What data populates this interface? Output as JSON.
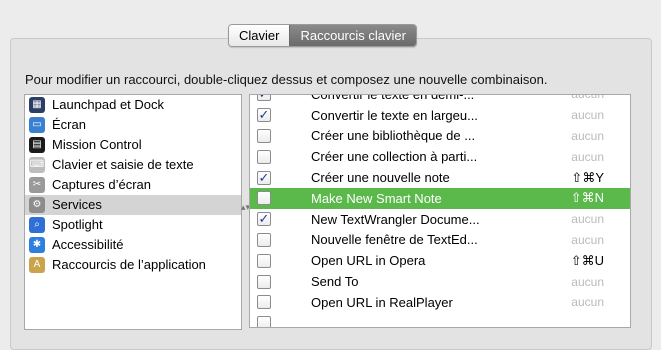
{
  "tabs": [
    {
      "label": "Clavier",
      "selected": false
    },
    {
      "label": "Raccourcis clavier",
      "selected": true
    }
  ],
  "instructions": "Pour modifier un raccourci, double-cliquez dessus et composez une nouvelle combinaison.",
  "categories": [
    {
      "label": "Launchpad et Dock",
      "icon": "launchpad-icon",
      "color": "#2d3e66"
    },
    {
      "label": "Écran",
      "icon": "display-icon",
      "color": "#3b7fd0"
    },
    {
      "label": "Mission Control",
      "icon": "mission-control-icon",
      "color": "#1b1b1b"
    },
    {
      "label": "Clavier et saisie de texte",
      "icon": "keyboard-icon",
      "color": "#bdbdbd"
    },
    {
      "label": "Captures d’écran",
      "icon": "screenshot-icon",
      "color": "#9a9a9a"
    },
    {
      "label": "Services",
      "icon": "gear-icon",
      "color": "#8c8c8c",
      "selected": true
    },
    {
      "label": "Spotlight",
      "icon": "spotlight-icon",
      "color": "#2f6fd6"
    },
    {
      "label": "Accessibilité",
      "icon": "accessibility-icon",
      "color": "#2f7fe0"
    },
    {
      "label": "Raccourcis de l’application",
      "icon": "app-shortcuts-icon",
      "color": "#caa44a"
    }
  ],
  "shortcuts": [
    {
      "name": "Convertir le texte en demi-...",
      "checked": true,
      "key": "aucun",
      "set": false
    },
    {
      "name": "Convertir le texte en largeu...",
      "checked": true,
      "key": "aucun",
      "set": false
    },
    {
      "name": "Créer une bibliothèque de ...",
      "checked": false,
      "key": "aucun",
      "set": false
    },
    {
      "name": "Créer une collection à parti...",
      "checked": false,
      "key": "aucun",
      "set": false
    },
    {
      "name": "Créer une nouvelle note",
      "checked": true,
      "key": "⇧⌘Y",
      "set": true
    },
    {
      "name": "Make New Smart Note",
      "checked": false,
      "key": "⇧⌘N",
      "set": true,
      "highlight": true
    },
    {
      "name": "New TextWrangler Docume...",
      "checked": true,
      "key": "aucun",
      "set": false
    },
    {
      "name": "Nouvelle fenêtre de TextEd...",
      "checked": false,
      "key": "aucun",
      "set": false
    },
    {
      "name": "Open URL in Opera",
      "checked": false,
      "key": "⇧⌘U",
      "set": true
    },
    {
      "name": "Send To",
      "checked": false,
      "key": "aucun",
      "set": false
    },
    {
      "name": "Open URL in RealPlayer",
      "checked": false,
      "key": "aucun",
      "set": false
    },
    {
      "name": "",
      "checked": false,
      "key": "",
      "set": false
    }
  ],
  "colors": {
    "highlight": "#5bb94c",
    "check": "#1c3f8f"
  }
}
